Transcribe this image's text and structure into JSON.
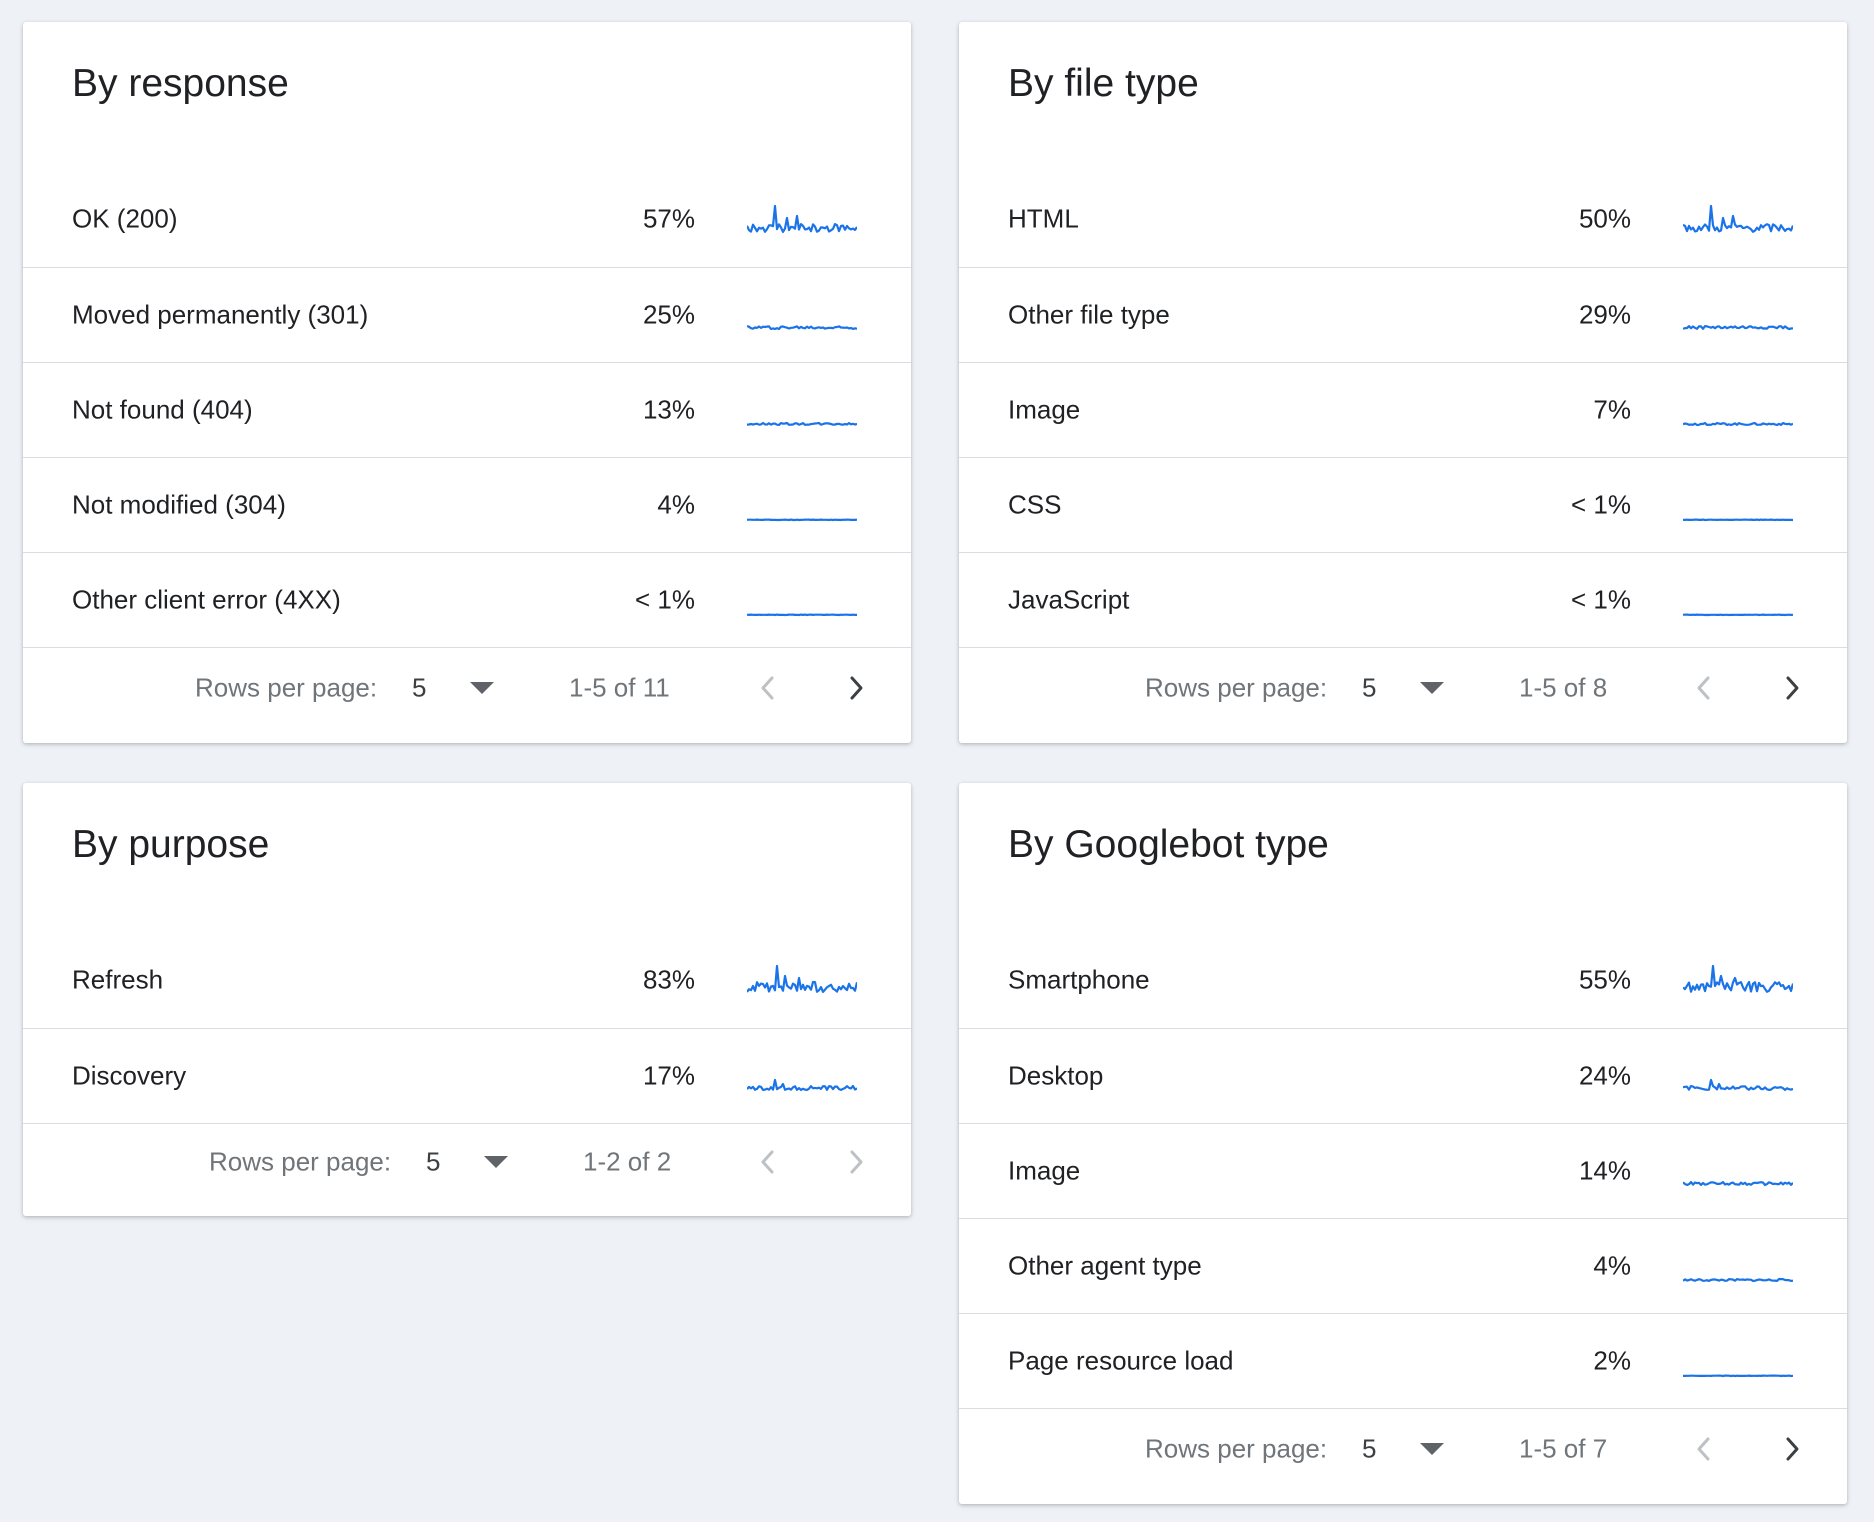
{
  "cards": {
    "response": {
      "title": "By response",
      "rows": [
        {
          "label": "OK (200)",
          "pct": "57%"
        },
        {
          "label": "Moved permanently (301)",
          "pct": "25%"
        },
        {
          "label": "Not found (404)",
          "pct": "13%"
        },
        {
          "label": "Not modified (304)",
          "pct": "4%"
        },
        {
          "label": "Other client error (4XX)",
          "pct": "< 1%"
        }
      ],
      "footer": {
        "rows_per_page_label": "Rows per page:",
        "rows_per_page_value": "5",
        "range": "1-5 of 11"
      }
    },
    "filetype": {
      "title": "By file type",
      "rows": [
        {
          "label": "HTML",
          "pct": "50%"
        },
        {
          "label": "Other file type",
          "pct": "29%"
        },
        {
          "label": "Image",
          "pct": "7%"
        },
        {
          "label": "CSS",
          "pct": "< 1%"
        },
        {
          "label": "JavaScript",
          "pct": "< 1%"
        }
      ],
      "footer": {
        "rows_per_page_label": "Rows per page:",
        "rows_per_page_value": "5",
        "range": "1-5 of 8"
      }
    },
    "purpose": {
      "title": "By purpose",
      "rows": [
        {
          "label": "Refresh",
          "pct": "83%"
        },
        {
          "label": "Discovery",
          "pct": "17%"
        }
      ],
      "footer": {
        "rows_per_page_label": "Rows per page:",
        "rows_per_page_value": "5",
        "range": "1-2 of 2"
      }
    },
    "googlebot": {
      "title": "By Googlebot type",
      "rows": [
        {
          "label": "Smartphone",
          "pct": "55%"
        },
        {
          "label": "Desktop",
          "pct": "24%"
        },
        {
          "label": "Image",
          "pct": "14%"
        },
        {
          "label": "Other agent type",
          "pct": "4%"
        },
        {
          "label": "Page resource load",
          "pct": "2%"
        }
      ],
      "footer": {
        "rows_per_page_label": "Rows per page:",
        "rows_per_page_value": "5",
        "range": "1-5 of 7"
      }
    }
  },
  "colors": {
    "sparkline": "#1a73e8",
    "nav_enabled": "#3c4043",
    "nav_disabled": "#bdc1c6"
  },
  "icons": {
    "dropdown": "triangle-down-icon",
    "prev": "chevron-left-icon",
    "next": "chevron-right-icon"
  }
}
